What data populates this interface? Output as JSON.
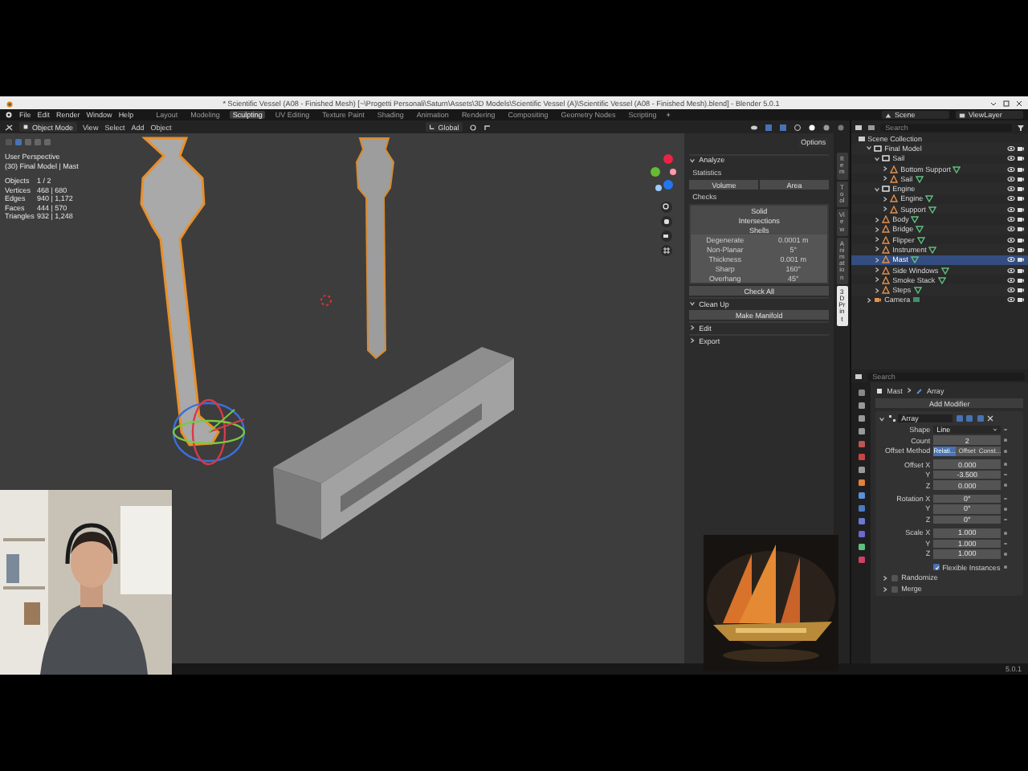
{
  "title_bar": {
    "title": "* Scientific Vessel (A08 - Finished Mesh) [~\\Progetti Personali\\Saturn\\Assets\\3D Models\\Scientific Vessel (A)\\Scientific Vessel (A08 - Finished Mesh).blend] - Blender 5.0.1"
  },
  "menus": [
    "File",
    "Edit",
    "Render",
    "Window",
    "Help"
  ],
  "workspaces": [
    {
      "label": "Layout",
      "selected": false
    },
    {
      "label": "Modeling",
      "selected": false
    },
    {
      "label": "Sculpting",
      "selected": true
    },
    {
      "label": "UV Editing",
      "selected": false
    },
    {
      "label": "Texture Paint",
      "selected": false
    },
    {
      "label": "Shading",
      "selected": false
    },
    {
      "label": "Animation",
      "selected": false
    },
    {
      "label": "Rendering",
      "selected": false
    },
    {
      "label": "Compositing",
      "selected": false
    },
    {
      "label": "Geometry Nodes",
      "selected": false
    },
    {
      "label": "Scripting",
      "selected": false
    }
  ],
  "add_workspace": "+",
  "scene": "Scene",
  "view_layer": "ViewLayer",
  "viewport_header": {
    "mode": "Object Mode",
    "menus": [
      "View",
      "Select",
      "Add",
      "Object"
    ],
    "orientation": "Global"
  },
  "overlay": {
    "view": "User Perspective",
    "context": "(30) Final Model | Mast",
    "stats": [
      {
        "label": "Objects",
        "value": "1 / 2"
      },
      {
        "label": "Vertices",
        "value": "468 | 680"
      },
      {
        "label": "Edges",
        "value": "940 | 1,172"
      },
      {
        "label": "Faces",
        "value": "444 | 570"
      },
      {
        "label": "Triangles",
        "value": "932 | 1,248"
      }
    ]
  },
  "sidebar": {
    "options": "Options",
    "tabs": [
      {
        "label": "Item",
        "selected": false
      },
      {
        "label": "Tool",
        "selected": false
      },
      {
        "label": "View",
        "selected": false
      },
      {
        "label": "Animation",
        "selected": false
      },
      {
        "label": "3D Print",
        "selected": true
      }
    ],
    "panels": [
      {
        "kind": "analyze",
        "title": "Analyze",
        "expanded": true,
        "statistics": "Statistics",
        "stat_buttons": [
          "Volume",
          "Area"
        ],
        "checks": "Checks",
        "check_buttons": [
          "Solid",
          "Intersections",
          "Shells"
        ],
        "params": [
          {
            "label": "Degenerate",
            "value": "0.0001 m"
          },
          {
            "label": "Non-Planar",
            "value": "5°"
          },
          {
            "label": "Thickness",
            "value": "0.001 m"
          },
          {
            "label": "Sharp",
            "value": "160°"
          },
          {
            "label": "Overhang",
            "value": "45°"
          }
        ],
        "check_all": "Check All"
      },
      {
        "kind": "clean_up",
        "title": "Clean Up",
        "expanded": true,
        "button": "Make Manifold"
      },
      {
        "kind": "empty",
        "title": "Edit",
        "expanded": false
      },
      {
        "kind": "empty",
        "title": "Export",
        "expanded": false
      }
    ]
  },
  "outliner": {
    "search_placeholder": "Search",
    "root": "Scene Collection",
    "items": [
      {
        "kind": "collection",
        "label": "Final Model",
        "expanded": true,
        "selected": false,
        "children": [
          {
            "kind": "collection",
            "label": "Sail",
            "expanded": true,
            "selected": false,
            "children": [
              {
                "kind": "object",
                "label": "Bottom Support",
                "expanded": false,
                "selected": false
              },
              {
                "kind": "object",
                "label": "Sail",
                "expanded": false,
                "selected": false
              }
            ]
          },
          {
            "kind": "collection",
            "label": "Engine",
            "expanded": true,
            "selected": false,
            "children": [
              {
                "kind": "object",
                "label": "Engine",
                "expanded": false,
                "selected": false
              },
              {
                "kind": "object",
                "label": "Support",
                "expanded": false,
                "selected": false
              }
            ]
          },
          {
            "kind": "object",
            "label": "Body",
            "expanded": false,
            "selected": false
          },
          {
            "kind": "object",
            "label": "Bridge",
            "expanded": false,
            "selected": false
          },
          {
            "kind": "object",
            "label": "Flipper",
            "expanded": false,
            "selected": false
          },
          {
            "kind": "object",
            "label": "Instrument",
            "expanded": false,
            "selected": false
          },
          {
            "kind": "object",
            "label": "Mast",
            "expanded": false,
            "selected": true
          },
          {
            "kind": "object",
            "label": "Side Windows",
            "expanded": false,
            "selected": false
          },
          {
            "kind": "object",
            "label": "Smoke Stack",
            "expanded": false,
            "selected": false
          },
          {
            "kind": "object",
            "label": "Steps",
            "expanded": false,
            "selected": false
          }
        ]
      },
      {
        "kind": "camera",
        "label": "Camera",
        "expanded": false,
        "selected": false
      }
    ]
  },
  "properties": {
    "search_placeholder": "Search",
    "breadcrumb": [
      "Mast",
      "Array"
    ],
    "add_modifier": "Add Modifier",
    "modifier": {
      "name": "Array",
      "rows": [
        {
          "kind": "dropdown",
          "label": "Shape",
          "value": "Line"
        },
        {
          "kind": "number",
          "label": "Count",
          "value": "2"
        },
        {
          "kind": "segmented",
          "label": "Offset Method",
          "options": [
            {
              "label": "Relati...",
              "selected": true
            },
            {
              "label": "Offset",
              "selected": false
            },
            {
              "label": "Const...",
              "selected": false
            }
          ]
        },
        {
          "kind": "vector",
          "fields": [
            {
              "label": "Offset X",
              "value": "0.000"
            },
            {
              "label": "Y",
              "value": "-3.500"
            },
            {
              "label": "Z",
              "value": "0.000"
            }
          ]
        },
        {
          "kind": "vector",
          "fields": [
            {
              "label": "Rotation X",
              "value": "0°"
            },
            {
              "label": "Y",
              "value": "0°"
            },
            {
              "label": "Z",
              "value": "0°"
            }
          ]
        },
        {
          "kind": "vector",
          "fields": [
            {
              "label": "Scale X",
              "value": "1.000"
            },
            {
              "label": "Y",
              "value": "1.000"
            },
            {
              "label": "Z",
              "value": "1.000"
            }
          ]
        },
        {
          "kind": "checkbox",
          "label": "Flexible Instances",
          "checked": true
        }
      ],
      "subpanels": [
        "Randomize",
        "Merge"
      ]
    }
  },
  "status_bar": {
    "version": "5.0.1"
  }
}
